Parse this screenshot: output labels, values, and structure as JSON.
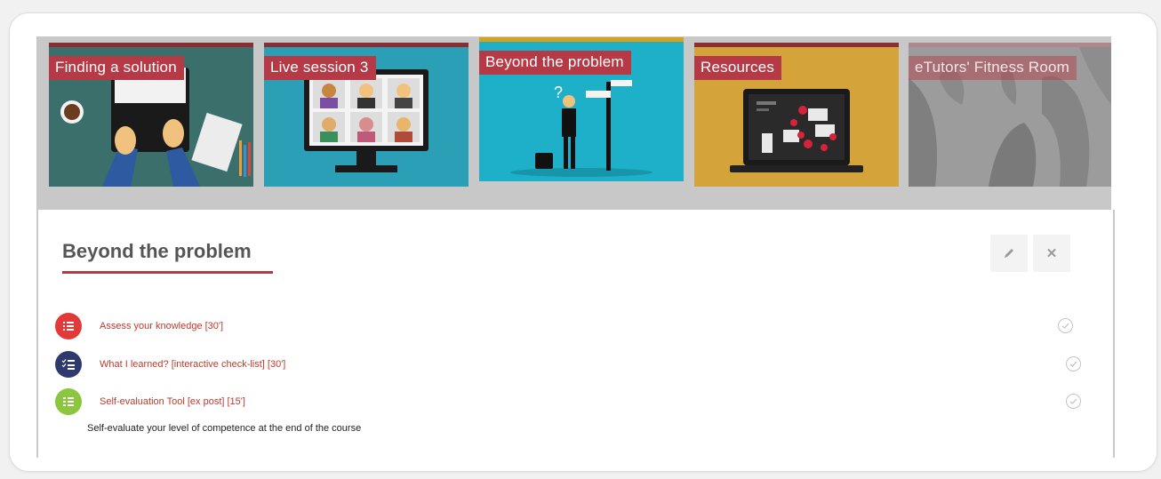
{
  "tiles": [
    {
      "label": "Finding a solution",
      "bg": "#3a6f6c",
      "bar": "#8b2e34"
    },
    {
      "label": "Live session 3",
      "bg": "#2a9fb5",
      "bar": "#8b2e34"
    },
    {
      "label": "Beyond the problem",
      "bg": "#1eb0c9",
      "bar": "#d8a21a"
    },
    {
      "label": "Resources",
      "bg": "#d4a43a",
      "bar": "#8b2e34"
    },
    {
      "label": "eTutors' Fitness Room",
      "bg": "#9c9c9c",
      "bar": "#b0888c"
    }
  ],
  "section": {
    "title": "Beyond the problem",
    "edit_icon": "pencil-icon",
    "close_icon": "close-icon"
  },
  "activities": [
    {
      "label": "Assess your knowledge [30']",
      "icon": "list-icon",
      "color": "#e23a3a"
    },
    {
      "label": "What I learned? [interactive check-list] [30']",
      "icon": "checklist-icon",
      "color": "#2e3a6e"
    },
    {
      "label": "Self-evaluation Tool [ex post] [15']",
      "icon": "questionnaire-icon",
      "color": "#8cc63f"
    }
  ],
  "description": "Self-evaluate your level of competence at the end of the course",
  "colors": {
    "accent": "#b63a45",
    "link": "#c0392b"
  }
}
